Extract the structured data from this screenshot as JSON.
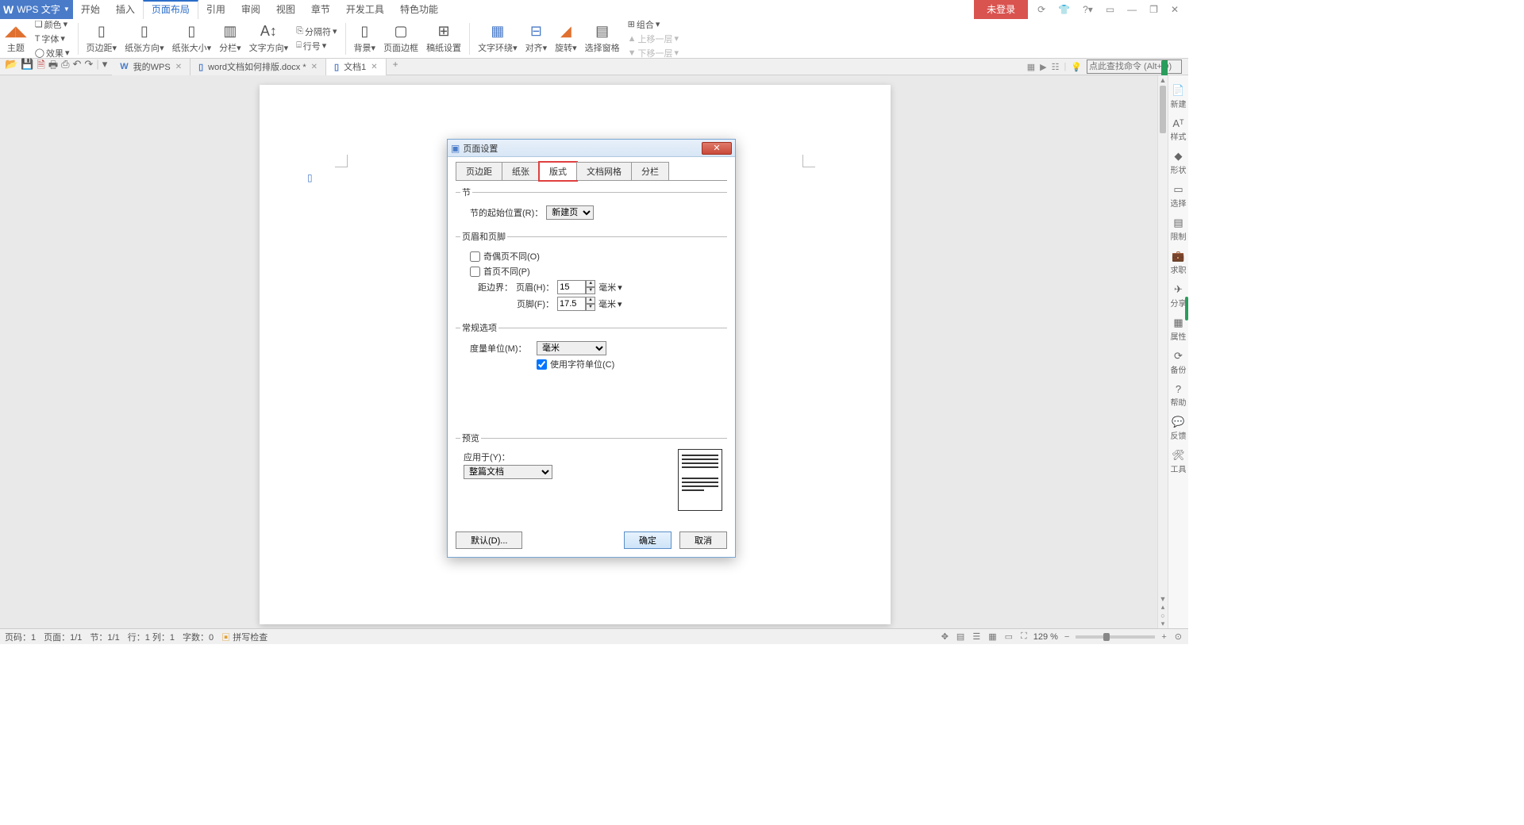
{
  "app": {
    "name": "WPS 文字"
  },
  "menu": {
    "tabs": [
      "开始",
      "插入",
      "页面布局",
      "引用",
      "审阅",
      "视图",
      "章节",
      "开发工具",
      "特色功能"
    ],
    "active_index": 2
  },
  "titlebar": {
    "unlogged": "未登录"
  },
  "ribbon": {
    "theme": "主题",
    "color": "颜色",
    "font": "字体",
    "effect": "效果",
    "margin": "页边距",
    "orient": "纸张方向",
    "size": "纸张大小",
    "columns": "分栏",
    "direction": "文字方向",
    "breaks": "分隔符",
    "lineno": "行号",
    "background": "背景",
    "border": "页面边框",
    "watermark": "稿纸设置",
    "wrap": "文字环绕",
    "align": "对齐",
    "rotate": "旋转",
    "pane": "选择窗格",
    "group": "组合",
    "front": "上移一层",
    "back": "下移一层"
  },
  "tabs": {
    "items": [
      {
        "label": "我的WPS",
        "active": false
      },
      {
        "label": "word文档如何排版.docx *",
        "active": false
      },
      {
        "label": "文档1",
        "active": true
      }
    ]
  },
  "search": {
    "placeholder": "点此查找命令 (Alt+Q)"
  },
  "side": {
    "items": [
      {
        "icon": "📄",
        "label": "新建"
      },
      {
        "icon": "Aᵀ",
        "label": "样式"
      },
      {
        "icon": "◆",
        "label": "形状"
      },
      {
        "icon": "▭",
        "label": "选择"
      },
      {
        "icon": "▤",
        "label": "限制"
      },
      {
        "icon": "💼",
        "label": "求职"
      },
      {
        "icon": "✈",
        "label": "分享"
      },
      {
        "icon": "▦",
        "label": "属性"
      },
      {
        "icon": "⟳",
        "label": "备份"
      },
      {
        "icon": "?",
        "label": "帮助"
      },
      {
        "icon": "💬",
        "label": "反馈"
      },
      {
        "icon": "🛠",
        "label": "工具"
      }
    ]
  },
  "dialog": {
    "title": "页面设置",
    "tabs": [
      "页边距",
      "纸张",
      "版式",
      "文档网格",
      "分栏"
    ],
    "active_tab": 2,
    "section": {
      "legend": "节",
      "start_label": "节的起始位置(R)：",
      "start_value": "新建页"
    },
    "headerfooter": {
      "legend": "页眉和页脚",
      "odd_even": "奇偶页不同(O)",
      "first_diff": "首页不同(P)",
      "edge_label": "距边界：",
      "header_label": "页眉(H)：",
      "header_value": "15",
      "footer_label": "页脚(F)：",
      "footer_value": "17.5",
      "unit": "毫米"
    },
    "general": {
      "legend": "常规选项",
      "measure_label": "度量单位(M)：",
      "measure_value": "毫米",
      "charunit": "使用字符单位(C)"
    },
    "preview": {
      "legend": "预览",
      "apply_label": "应用于(Y)：",
      "apply_value": "整篇文档"
    },
    "buttons": {
      "default": "默认(D)...",
      "ok": "确定",
      "cancel": "取消"
    }
  },
  "status": {
    "page_no": "页码：1",
    "page": "页面：1/1",
    "section": "节：1/1",
    "line": "行：1 列：1",
    "words": "字数：0",
    "spell": "拼写检查",
    "zoom": "129 %"
  }
}
